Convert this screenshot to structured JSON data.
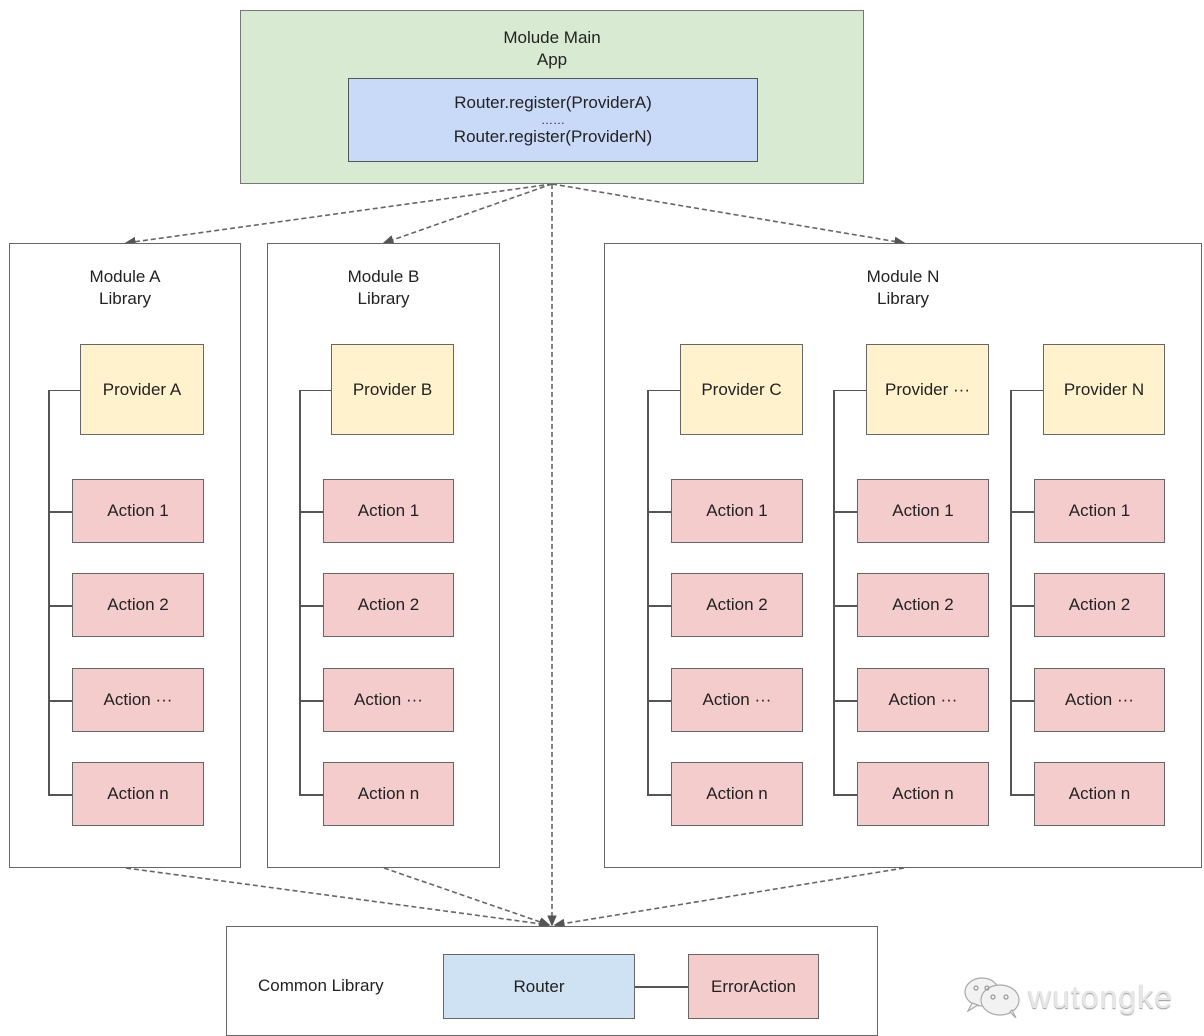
{
  "main_app": {
    "title_line1": "Molude Main",
    "title_line2": "App",
    "register_line1": "Router.register(ProviderA)",
    "register_ellipsis": "……",
    "register_line2": "Router.register(ProviderN)"
  },
  "modules": [
    {
      "title_line1": "Module A",
      "title_line2": "Library",
      "providers": [
        {
          "label": "Provider A",
          "actions": [
            "Action 1",
            "Action 2",
            "Action ···",
            "Action n"
          ]
        }
      ]
    },
    {
      "title_line1": "Module B",
      "title_line2": "Library",
      "providers": [
        {
          "label": "Provider B",
          "actions": [
            "Action 1",
            "Action 2",
            "Action ···",
            "Action n"
          ]
        }
      ]
    },
    {
      "title_line1": "Module N",
      "title_line2": "Library",
      "providers": [
        {
          "label": "Provider C",
          "actions": [
            "Action 1",
            "Action 2",
            "Action ···",
            "Action n"
          ]
        },
        {
          "label": "Provider ···",
          "actions": [
            "Action 1",
            "Action 2",
            "Action ···",
            "Action n"
          ]
        },
        {
          "label": "Provider N",
          "actions": [
            "Action 1",
            "Action 2",
            "Action ···",
            "Action n"
          ]
        }
      ]
    }
  ],
  "common": {
    "title": "Common Library",
    "router": "Router",
    "error_action": "ErrorAction"
  },
  "watermark": {
    "icon": "wechat-icon",
    "text": "wutongke"
  },
  "colors": {
    "main_app": "#d9ead3",
    "register": "#c9daf8",
    "provider": "#fff2cc",
    "action": "#f4cccc",
    "router": "#cfe2f3"
  }
}
